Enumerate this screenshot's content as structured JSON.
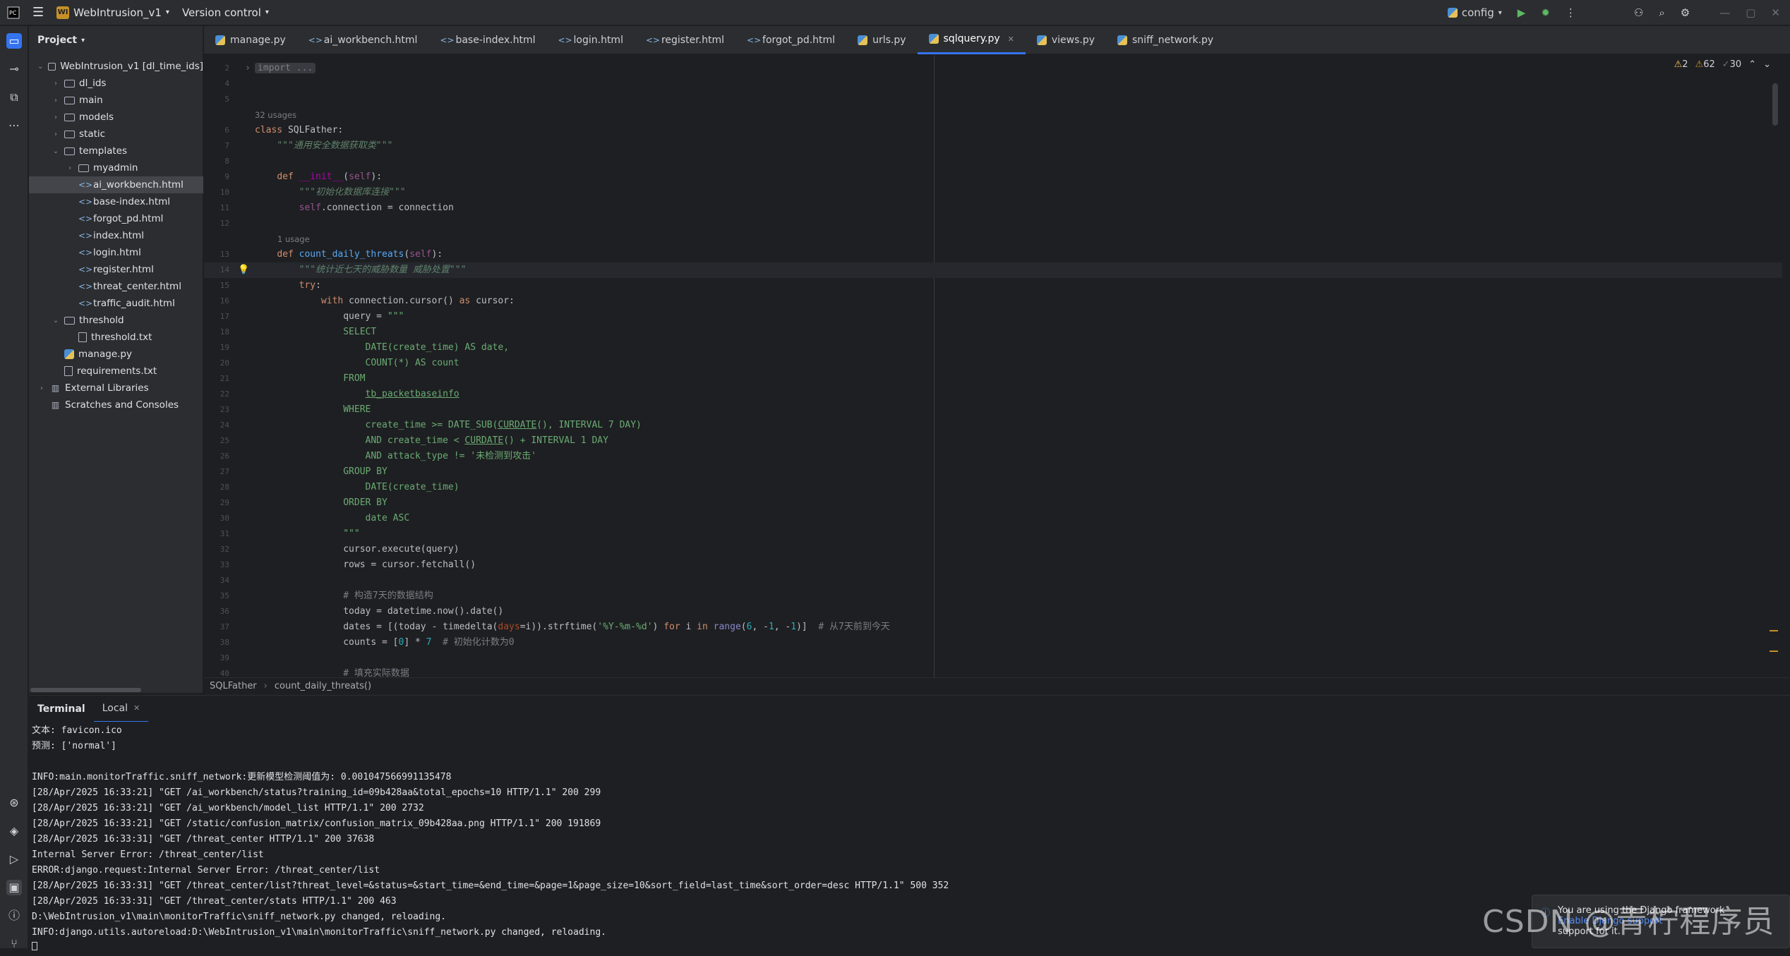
{
  "title_bar": {
    "project_badge": "WI",
    "project_name": "WebIntrusion_v1",
    "vcs": "Version control",
    "run_config": "config"
  },
  "project_panel": {
    "title": "Project",
    "items": [
      {
        "label": "WebIntrusion_v1 [dl_time_ids]",
        "type": "folder",
        "depth": 0,
        "expanded": true
      },
      {
        "label": "dl_ids",
        "type": "folder",
        "depth": 1,
        "expanded": false
      },
      {
        "label": "main",
        "type": "folder",
        "depth": 1,
        "expanded": false
      },
      {
        "label": "models",
        "type": "folder",
        "depth": 1,
        "expanded": false
      },
      {
        "label": "static",
        "type": "folder",
        "depth": 1,
        "expanded": false
      },
      {
        "label": "templates",
        "type": "folder",
        "depth": 1,
        "expanded": true
      },
      {
        "label": "myadmin",
        "type": "folder",
        "depth": 2,
        "expanded": false
      },
      {
        "label": "ai_workbench.html",
        "type": "html",
        "depth": 2,
        "selected": true
      },
      {
        "label": "base-index.html",
        "type": "html",
        "depth": 2
      },
      {
        "label": "forgot_pd.html",
        "type": "html",
        "depth": 2
      },
      {
        "label": "index.html",
        "type": "html",
        "depth": 2
      },
      {
        "label": "login.html",
        "type": "html",
        "depth": 2
      },
      {
        "label": "register.html",
        "type": "html",
        "depth": 2
      },
      {
        "label": "threat_center.html",
        "type": "html",
        "depth": 2
      },
      {
        "label": "traffic_audit.html",
        "type": "html",
        "depth": 2
      },
      {
        "label": "threshold",
        "type": "folder",
        "depth": 1,
        "expanded": true
      },
      {
        "label": "threshold.txt",
        "type": "txt",
        "depth": 2
      },
      {
        "label": "manage.py",
        "type": "py",
        "depth": 1
      },
      {
        "label": "requirements.txt",
        "type": "txt",
        "depth": 1
      },
      {
        "label": "External Libraries",
        "type": "lib",
        "depth": 0,
        "expanded": false
      },
      {
        "label": "Scratches and Consoles",
        "type": "lib",
        "depth": 0
      }
    ]
  },
  "tabs": [
    {
      "label": "manage.py",
      "type": "py"
    },
    {
      "label": "ai_workbench.html",
      "type": "html"
    },
    {
      "label": "base-index.html",
      "type": "html"
    },
    {
      "label": "login.html",
      "type": "html"
    },
    {
      "label": "register.html",
      "type": "html"
    },
    {
      "label": "forgot_pd.html",
      "type": "html"
    },
    {
      "label": "urls.py",
      "type": "py"
    },
    {
      "label": "sqlquery.py",
      "type": "py",
      "active": true
    },
    {
      "label": "views.py",
      "type": "py"
    },
    {
      "label": "sniff_network.py",
      "type": "py"
    }
  ],
  "inspections": {
    "warnings": "2",
    "weak_warnings": "62",
    "typos": "30"
  },
  "editor": {
    "usages_class": "32 usages",
    "usages_method": "1 usage",
    "lines": [
      {
        "n": "2",
        "html": "<span class=\"fold-box\">import ...</span>"
      },
      {
        "n": "4",
        "html": ""
      },
      {
        "n": "5",
        "html": ""
      },
      {
        "n": "6",
        "html": "<span class=\"kw\">class</span> SQLFather:"
      },
      {
        "n": "7",
        "html": "    <span class=\"doc\">\"\"\"通用安全数据获取类\"\"\"</span>"
      },
      {
        "n": "8",
        "html": ""
      },
      {
        "n": "9",
        "html": "    <span class=\"kw\">def</span> <span class=\"magic\">__init__</span>(<span class=\"self\">self</span>):"
      },
      {
        "n": "10",
        "html": "        <span class=\"doc\">\"\"\"初始化数据库连接\"\"\"</span>"
      },
      {
        "n": "11",
        "html": "        <span class=\"self\">self</span>.connection = connection"
      },
      {
        "n": "12",
        "html": ""
      },
      {
        "n": "13",
        "html": "    <span class=\"kw\">def</span> <span class=\"fn\">count_daily_threats</span>(<span class=\"self\">self</span>):"
      },
      {
        "n": "14",
        "html": "        <span class=\"doc\">\"\"\"统计近七天的威胁数量 威胁处置\"\"\"</span>",
        "current": true
      },
      {
        "n": "15",
        "html": "        <span class=\"kw\">try</span>:"
      },
      {
        "n": "16",
        "html": "            <span class=\"kw\">with</span> connection.cursor() <span class=\"kw\">as</span> cursor:"
      },
      {
        "n": "17",
        "html": "                query = <span class=\"str\">\"\"\"</span>"
      },
      {
        "n": "18",
        "html": "<span class=\"str\">                SELECT</span>"
      },
      {
        "n": "19",
        "html": "<span class=\"str\">                    DATE(create_time) AS date,</span>"
      },
      {
        "n": "20",
        "html": "<span class=\"str\">                    COUNT(*) AS count</span>"
      },
      {
        "n": "21",
        "html": "<span class=\"str\">                FROM</span>"
      },
      {
        "n": "22",
        "html": "<span class=\"str\">                    <u>tb_packetbaseinfo</u></span>"
      },
      {
        "n": "23",
        "html": "<span class=\"str\">                WHERE</span>"
      },
      {
        "n": "24",
        "html": "<span class=\"str\">                    create_time &gt;= DATE_SUB(<u>CURDATE</u>(), INTERVAL 7 DAY)</span>"
      },
      {
        "n": "25",
        "html": "<span class=\"str\">                    AND create_time &lt; <u>CURDATE</u>() + INTERVAL 1 DAY</span>"
      },
      {
        "n": "26",
        "html": "<span class=\"str\">                    AND attack_type != '未检测到攻击'</span>"
      },
      {
        "n": "27",
        "html": "<span class=\"str\">                GROUP BY</span>"
      },
      {
        "n": "28",
        "html": "<span class=\"str\">                    DATE(create_time)</span>"
      },
      {
        "n": "29",
        "html": "<span class=\"str\">                ORDER BY</span>"
      },
      {
        "n": "30",
        "html": "<span class=\"str\">                    date ASC</span>"
      },
      {
        "n": "31",
        "html": "<span class=\"str\">                \"\"\"</span>"
      },
      {
        "n": "32",
        "html": "                cursor.execute(query)"
      },
      {
        "n": "33",
        "html": "                rows = cursor.fetchall()"
      },
      {
        "n": "34",
        "html": ""
      },
      {
        "n": "35",
        "html": "                <span class=\"cmt\"># 构造7天的数据结构</span>"
      },
      {
        "n": "36",
        "html": "                today = datetime.now().date()"
      },
      {
        "n": "37",
        "html": "                dates = [(today - timedelta(<span class=\"kwarg\">days</span>=i)).strftime(<span class=\"str\">'%Y-%m-%d'</span>) <span class=\"kw\">for</span> i <span class=\"kw\">in</span> <span class=\"builtin\">range</span>(<span class=\"num\">6</span>, -<span class=\"num\">1</span>, -<span class=\"num\">1</span>)]  <span class=\"cmt\"># 从7天前到今天</span>"
      },
      {
        "n": "38",
        "html": "                counts = [<span class=\"num\">0</span>] * <span class=\"num\">7</span>  <span class=\"cmt\"># 初始化计数为0</span>"
      },
      {
        "n": "39",
        "html": ""
      },
      {
        "n": "40",
        "html": "                <span class=\"cmt\"># 填充实际数据</span>"
      }
    ]
  },
  "breadcrumb": [
    "SQLFather",
    "count_daily_threats()"
  ],
  "terminal": {
    "title": "Terminal",
    "tab": "Local",
    "lines": [
      "文本: favicon.ico",
      "预测: ['normal']",
      "",
      "INFO:main.monitorTraffic.sniff_network:更新模型检测阈值为: 0.001047566991135478",
      "[28/Apr/2025 16:33:21] \"GET /ai_workbench/status?training_id=09b428aa&total_epochs=10 HTTP/1.1\" 200 299",
      "[28/Apr/2025 16:33:21] \"GET /ai_workbench/model_list HTTP/1.1\" 200 2732",
      "[28/Apr/2025 16:33:21] \"GET /static/confusion_matrix/confusion_matrix_09b428aa.png HTTP/1.1\" 200 191869",
      "[28/Apr/2025 16:33:31] \"GET /threat_center HTTP/1.1\" 200 37638",
      "Internal Server Error: /threat_center/list",
      "ERROR:django.request:Internal Server Error: /threat_center/list",
      "[28/Apr/2025 16:33:31] \"GET /threat_center/list?threat_level=&status=&start_time=&end_time=&page=1&page_size=10&sort_field=last_time&sort_order=desc HTTP/1.1\" 500 352",
      "[28/Apr/2025 16:33:31] \"GET /threat_center/stats HTTP/1.1\" 200 463",
      "D:\\WebIntrusion_v1\\main\\monitorTraffic\\sniff_network.py changed, reloading.",
      "INFO:django.utils.autoreload:D:\\WebIntrusion_v1\\main\\monitorTraffic\\sniff_network.py changed, reloading."
    ]
  },
  "notification": {
    "line1": "You are using the Django framework",
    "line2_link": "Enable Django support",
    "line3": "support for it."
  },
  "watermark": "CSDN @青柠程序员"
}
